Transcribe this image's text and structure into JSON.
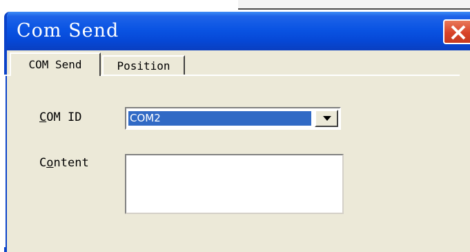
{
  "window": {
    "title": "Com Send",
    "colors": {
      "titlebar": "#0a54e3",
      "close": "#d8432a",
      "face": "#ece9d8",
      "selection": "#316ac5"
    }
  },
  "tabs": [
    {
      "label": "COM Send",
      "active": true
    },
    {
      "label": "Position",
      "active": false
    }
  ],
  "form": {
    "com_id": {
      "label_mnemonic": "C",
      "label_rest": "OM ID",
      "value": "COM2"
    },
    "content": {
      "label_start": "C",
      "label_mnemonic": "o",
      "label_rest": "ntent",
      "value": ""
    }
  },
  "icons": {
    "close": "close-icon",
    "dropdown": "chevron-down-icon"
  }
}
